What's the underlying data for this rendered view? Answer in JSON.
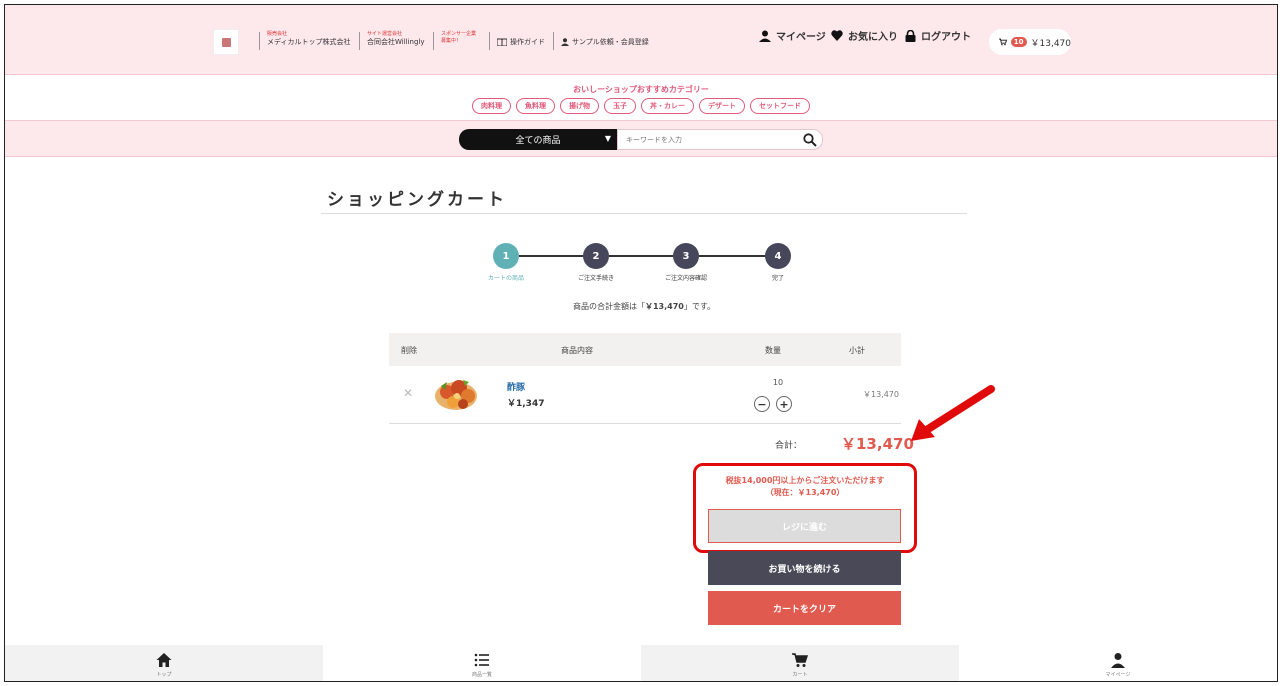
{
  "header": {
    "company1_small": "販売会社",
    "company1": "メディカルトップ株式会社",
    "company2_small": "サイト運営会社",
    "company2": "合同会社Willingly",
    "sponsor_small": "スポンサー企業",
    "sponsor": "募集中！",
    "guide_link": "操作ガイド",
    "register_link": "サンプル依頼・会員登録",
    "mypage": "マイページ",
    "favorites": "お気に入り",
    "logout": "ログアウト",
    "cart_count": "10",
    "cart_total": "￥13,470"
  },
  "categories": {
    "title": "おいしーショップおすすめカテゴリー",
    "items": [
      "肉料理",
      "魚料理",
      "揚げ物",
      "玉子",
      "丼・カレー",
      "デザート",
      "セットフード"
    ]
  },
  "search": {
    "select_value": "全ての商品",
    "placeholder": "キーワードを入力"
  },
  "page": {
    "title": "ショッピングカート",
    "summary_pre": "商品の合計金額は「",
    "summary_amount": "￥13,470",
    "summary_post": "」です。"
  },
  "steps": [
    {
      "num": "1",
      "label": "カートの商品"
    },
    {
      "num": "2",
      "label": "ご注文手続き"
    },
    {
      "num": "3",
      "label": "ご注文内容確認"
    },
    {
      "num": "4",
      "label": "完了"
    }
  ],
  "table": {
    "headers": {
      "delete": "削除",
      "item": "商品内容",
      "qty": "数量",
      "subtotal": "小計"
    },
    "rows": [
      {
        "name": "酢豚",
        "price": "￥1,347",
        "qty": "10",
        "subtotal": "￥13,470"
      }
    ]
  },
  "totals": {
    "label": "合計：",
    "value": "￥13,470"
  },
  "notice": {
    "line1": "税抜14,000円以上からご注文いただけます",
    "line2": "（現在：￥13,470）"
  },
  "buttons": {
    "checkout": "レジに進む",
    "continue": "お買い物を続ける",
    "clear": "カートをクリア"
  },
  "bottom_nav": [
    {
      "label": "トップ",
      "icon": "home-icon"
    },
    {
      "label": "商品一覧",
      "icon": "list-icon"
    },
    {
      "label": "カート",
      "icon": "cart-icon"
    },
    {
      "label": "マイページ",
      "icon": "user-icon"
    }
  ],
  "colors": {
    "header_bg": "#fde8ec",
    "accent_red": "#e05a4f",
    "teal": "#5fb1b6",
    "dark": "#4a4957",
    "highlight": "#e10a0a"
  }
}
